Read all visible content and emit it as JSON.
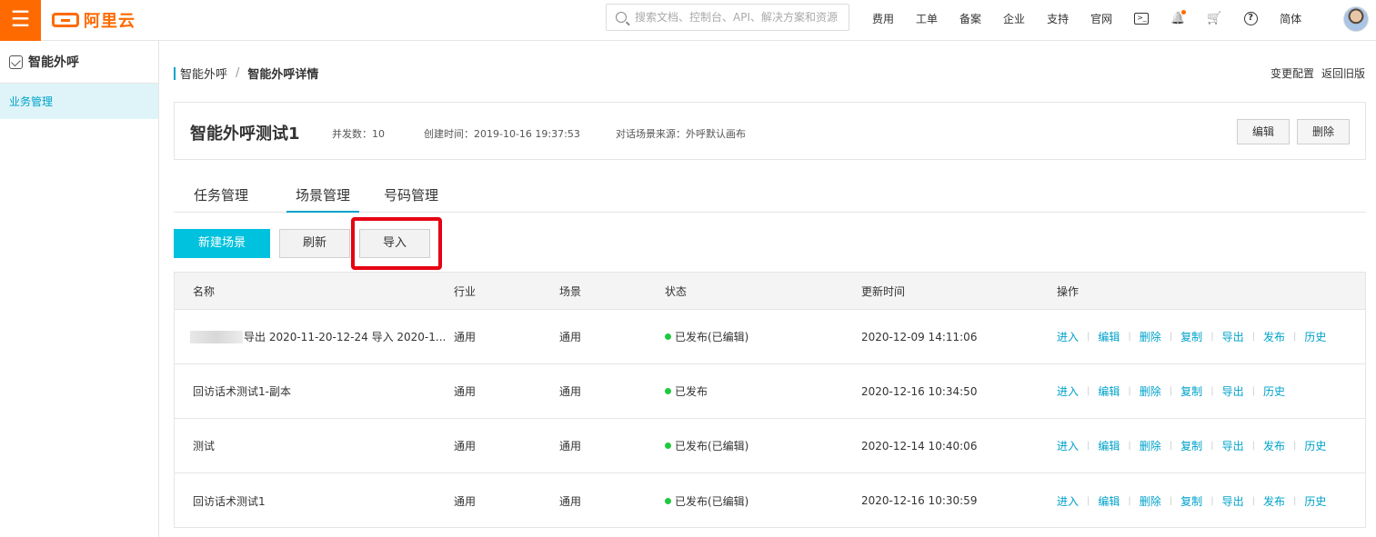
{
  "topbar": {
    "menu_glyph": "☰",
    "logo_text": "阿里云",
    "search_placeholder": "搜索文档、控制台、API、解决方案和资源",
    "nav_links": [
      "费用",
      "工单",
      "备案",
      "企业",
      "支持",
      "官网"
    ],
    "terminal_glyph": ">_",
    "bell_glyph": "🔔",
    "cart_glyph": "🛒",
    "help_glyph": "?",
    "language": "简体"
  },
  "sidebar": {
    "title": "智能外呼",
    "items": [
      {
        "label": "业务管理"
      }
    ]
  },
  "breadcrumb": {
    "root": "智能外呼",
    "separator": "/",
    "current": "智能外呼详情"
  },
  "header_actions": {
    "change_config": "变更配置",
    "back_old": "返回旧版"
  },
  "info_card": {
    "title": "智能外呼测试1",
    "concurrency": "并发数：10",
    "created": "创建时间：2019-10-16 19:37:53",
    "scene_source": "对话场景来源：外呼默认画布",
    "edit_label": "编辑",
    "delete_label": "删除"
  },
  "tabs": [
    {
      "label": "任务管理"
    },
    {
      "label": "场景管理"
    },
    {
      "label": "号码管理"
    }
  ],
  "toolbar": {
    "new_scene": "新建场景",
    "refresh": "刷新",
    "import": "导入"
  },
  "table": {
    "columns": [
      "名称",
      "行业",
      "场景",
      "状态",
      "更新时间",
      "操作"
    ],
    "rows": [
      {
        "name": "导出 2020-11-20-12-24 导入 2020-1...",
        "industry": "通用",
        "scene": "通用",
        "status": "已发布(已编辑)",
        "updated": "2020-12-09 14:11:06",
        "ops": [
          "进入",
          "编辑",
          "删除",
          "复制",
          "导出",
          "发布",
          "历史"
        ]
      },
      {
        "name": "回访话术测试1-副本",
        "industry": "通用",
        "scene": "通用",
        "status": "已发布",
        "updated": "2020-12-16 10:34:50",
        "ops": [
          "进入",
          "编辑",
          "删除",
          "复制",
          "导出",
          "历史"
        ]
      },
      {
        "name": "测试",
        "industry": "通用",
        "scene": "通用",
        "status": "已发布(已编辑)",
        "updated": "2020-12-14 10:40:06",
        "ops": [
          "进入",
          "编辑",
          "删除",
          "复制",
          "导出",
          "发布",
          "历史"
        ]
      },
      {
        "name": "回访话术测试1",
        "industry": "通用",
        "scene": "通用",
        "status": "已发布(已编辑)",
        "updated": "2020-12-16 10:30:59",
        "ops": [
          "进入",
          "编辑",
          "删除",
          "复制",
          "导出",
          "发布",
          "历史"
        ]
      }
    ]
  },
  "colors": {
    "brand": "#ff6a00",
    "accent": "#00c1de",
    "link": "#00a2ca",
    "status_ok": "#1fc93d",
    "highlight": "#e60012"
  }
}
